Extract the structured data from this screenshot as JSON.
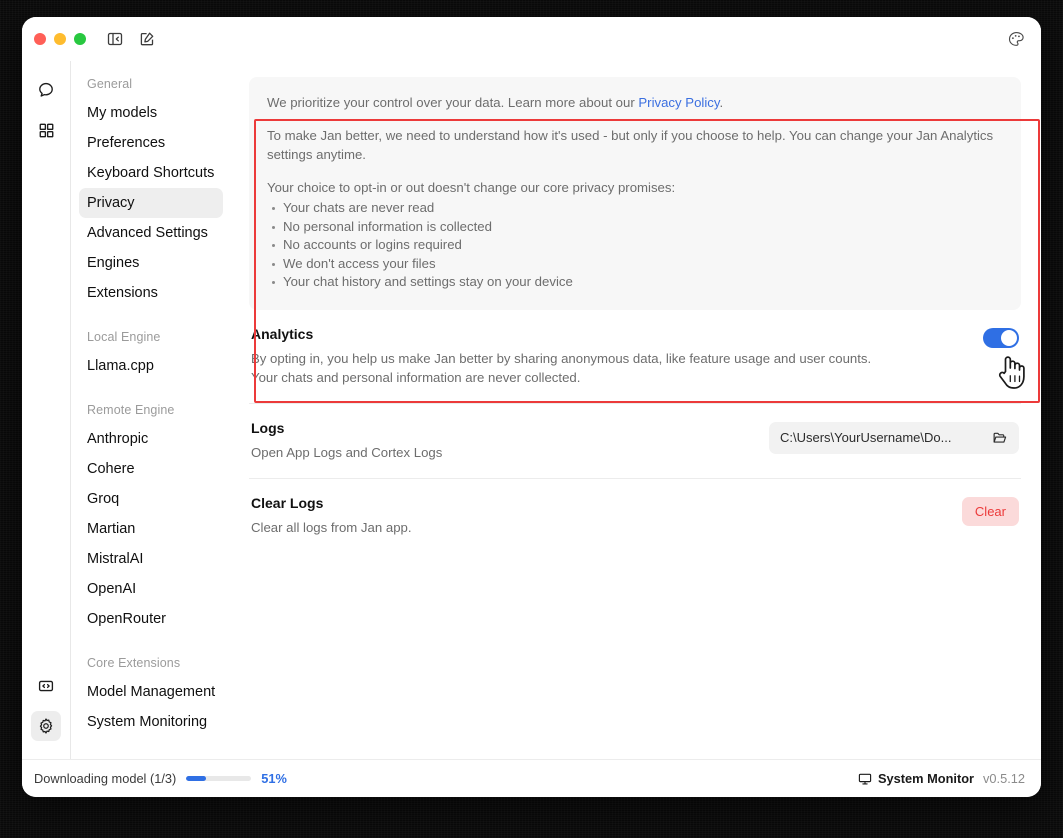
{
  "window": {
    "titlebar": {
      "traffic_lights": [
        "close",
        "minimize",
        "maximize"
      ],
      "sidebar_toggle_icon": "panel-collapse-icon",
      "new_chat_icon": "compose-icon",
      "theme_icon": "palette-icon"
    }
  },
  "rail": {
    "items": [
      {
        "icon": "chat-bubble-icon",
        "active": false
      },
      {
        "icon": "grid-apps-icon",
        "active": false
      }
    ],
    "bottom_items": [
      {
        "icon": "code-icon",
        "active": false
      },
      {
        "icon": "gear-icon",
        "active": true
      }
    ]
  },
  "nav": {
    "groups": [
      {
        "label": "General",
        "items": [
          {
            "label": "My models",
            "active": false
          },
          {
            "label": "Preferences",
            "active": false
          },
          {
            "label": "Keyboard Shortcuts",
            "active": false
          },
          {
            "label": "Privacy",
            "active": true
          },
          {
            "label": "Advanced Settings",
            "active": false
          },
          {
            "label": "Engines",
            "active": false
          },
          {
            "label": "Extensions",
            "active": false
          }
        ]
      },
      {
        "label": "Local Engine",
        "items": [
          {
            "label": "Llama.cpp",
            "active": false
          }
        ]
      },
      {
        "label": "Remote Engine",
        "items": [
          {
            "label": "Anthropic",
            "active": false
          },
          {
            "label": "Cohere",
            "active": false
          },
          {
            "label": "Groq",
            "active": false
          },
          {
            "label": "Martian",
            "active": false
          },
          {
            "label": "MistralAI",
            "active": false
          },
          {
            "label": "OpenAI",
            "active": false
          },
          {
            "label": "OpenRouter",
            "active": false
          }
        ]
      },
      {
        "label": "Core Extensions",
        "items": [
          {
            "label": "Model Management",
            "active": false
          },
          {
            "label": "System Monitoring",
            "active": false
          }
        ]
      }
    ]
  },
  "privacy_card": {
    "paragraph1_before_link": "We prioritize your control over your data. Learn more about our ",
    "link_label": "Privacy Policy",
    "paragraph1_after_link": ".",
    "paragraph2": "To make Jan better, we need to understand how it's used - but only if you choose to help. You can change your Jan Analytics settings anytime.",
    "paragraph3": "Your choice to opt-in or out doesn't change our core privacy promises:",
    "promises": [
      "Your chats are never read",
      "No personal information is collected",
      "No accounts or logins required",
      "We don't access your files",
      "Your chat history and settings stay on your device"
    ]
  },
  "settings_rows": {
    "analytics": {
      "title": "Analytics",
      "description": "By opting in, you help us make Jan better by sharing anonymous data, like feature usage and user counts. Your chats and personal information are never collected.",
      "toggle_on": true,
      "toggle_color": "#2f6fe4"
    },
    "logs": {
      "title": "Logs",
      "description": "Open App Logs and Cortex Logs",
      "path_value": "C:\\Users\\YourUsername\\Do...",
      "folder_icon": "folder-open-icon"
    },
    "clear_logs": {
      "title": "Clear Logs",
      "description": "Clear all logs from Jan app.",
      "button_label": "Clear",
      "button_color": "#ec3a3a"
    }
  },
  "statusbar": {
    "download_text": "Downloading model (1/3)",
    "progress_percent": "51%",
    "progress_fill_ratio": 30,
    "system_monitor_label": "System Monitor",
    "system_monitor_icon": "monitor-icon",
    "version": "v0.5.12"
  },
  "annotation": {
    "color": "#ec3a3a"
  }
}
